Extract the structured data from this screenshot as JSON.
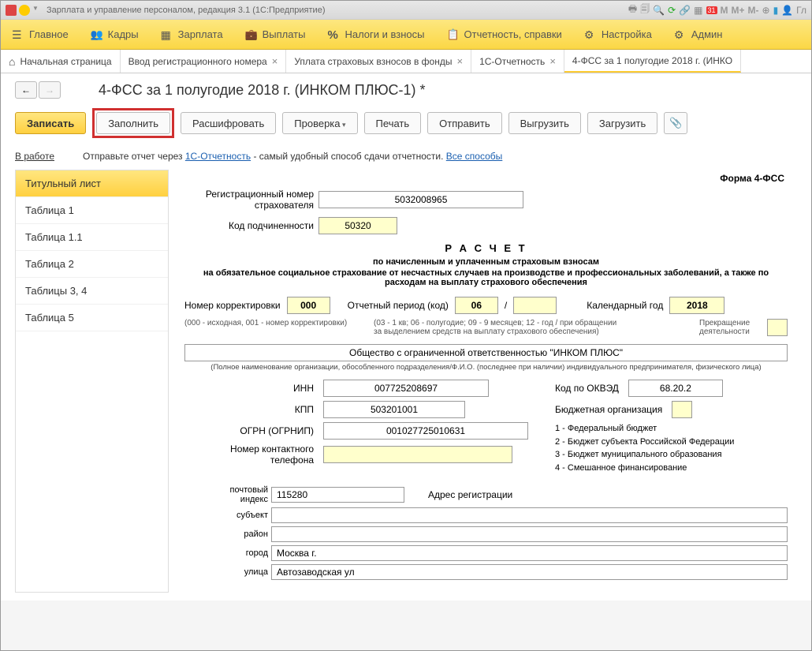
{
  "titlebar": {
    "app_title": "Зарплата и управление персоналом, редакция 3.1  (1С:Предприятие)",
    "m_buttons": [
      "M",
      "M+",
      "M-"
    ],
    "user_label": "Гл"
  },
  "navbar": {
    "items": [
      {
        "label": "Главное",
        "icon": "menu"
      },
      {
        "label": "Кадры",
        "icon": "people"
      },
      {
        "label": "Зарплата",
        "icon": "calc"
      },
      {
        "label": "Выплаты",
        "icon": "briefcase"
      },
      {
        "label": "Налоги и взносы",
        "icon": "percent"
      },
      {
        "label": "Отчетность, справки",
        "icon": "doc"
      },
      {
        "label": "Настройка",
        "icon": "gear"
      },
      {
        "label": "Админ",
        "icon": "gear"
      }
    ]
  },
  "tabs": [
    {
      "label": "Начальная страница",
      "closable": false,
      "home": true
    },
    {
      "label": "Ввод регистрационного номера",
      "closable": true
    },
    {
      "label": "Уплата страховых взносов в фонды",
      "closable": true
    },
    {
      "label": "1С-Отчетность",
      "closable": true
    },
    {
      "label": "4-ФСС за 1 полугодие 2018 г. (ИНКО",
      "closable": false,
      "active": true
    }
  ],
  "page_title": "4-ФСС за 1 полугодие 2018 г. (ИНКОМ ПЛЮС-1) *",
  "toolbar": {
    "save": "Записать",
    "fill": "Заполнить",
    "decode": "Расшифровать",
    "check": "Проверка",
    "print": "Печать",
    "send": "Отправить",
    "export": "Выгрузить",
    "import": "Загрузить"
  },
  "status": {
    "label": "В работе",
    "text_pre": "Отправьте отчет через ",
    "link1": "1С-Отчетность",
    "text_mid": " - самый удобный способ сдачи отчетности. ",
    "link2": "Все способы"
  },
  "sidebar": {
    "items": [
      {
        "label": "Титульный лист",
        "active": true
      },
      {
        "label": "Таблица 1"
      },
      {
        "label": "Таблица 1.1"
      },
      {
        "label": "Таблица 2"
      },
      {
        "label": "Таблицы 3, 4"
      },
      {
        "label": "Таблица 5"
      }
    ]
  },
  "form": {
    "form_name": "Форма 4-ФСС",
    "reg_label": "Регистрационный номер страхователя",
    "reg_value": "5032008965",
    "sub_code_label": "Код подчиненности",
    "sub_code_value": "50320",
    "calc_title": "Р А С Ч Е Т",
    "calc_sub1": "по начисленным и уплаченным страховым взносам",
    "calc_sub2": "на обязательное социальное страхование от несчастных случаев на производстве и профессиональных заболеваний, а также по расходам на выплату страхового обеспечения",
    "corr_label": "Номер корректировки",
    "corr_value": "000",
    "period_label": "Отчетный период (код)",
    "period_value": "06",
    "slash": "/",
    "year_label": "Календарный год",
    "year_value": "2018",
    "corr_note": "(000 - исходная, 001 - номер корректировки)",
    "period_note": "(03 - 1 кв; 06 - полугодие; 09 - 9 месяцев; 12 - год / при обращении за выделением средств на выплату страхового обеспечения)",
    "cease_label": "Прекращение деятельности",
    "org_name": "Общество с ограниченной ответственностью \"ИНКОМ ПЛЮС\"",
    "org_note": "(Полное наименование организации, обособленного подразделения/Ф.И.О. (последнее при наличии) индивидуального предпринимателя, физического лица)",
    "inn_label": "ИНН",
    "inn_value": "007725208697",
    "kpp_label": "КПП",
    "kpp_value": "503201001",
    "ogrn_label": "ОГРН (ОГРНИП)",
    "ogrn_value": "001027725010631",
    "phone_label": "Номер контактного телефона",
    "phone_value": "",
    "okved_label": "Код по ОКВЭД",
    "okved_value": "68.20.2",
    "budget_label": "Бюджетная организация",
    "budget_items": [
      "1 - Федеральный бюджет",
      "2 - Бюджет субъекта Российской Федерации",
      "3 - Бюджет муниципального образования",
      "4 - Смешанное финансирование"
    ],
    "postcode_label": "почтовый индекс",
    "postcode_value": "115280",
    "addr_reg_label": "Адрес регистрации",
    "subject_label": "субъект",
    "subject_value": "",
    "district_label": "район",
    "district_value": "",
    "city_label": "город",
    "city_value": "Москва г.",
    "street_label": "улица",
    "street_value": "Автозаводская ул"
  }
}
